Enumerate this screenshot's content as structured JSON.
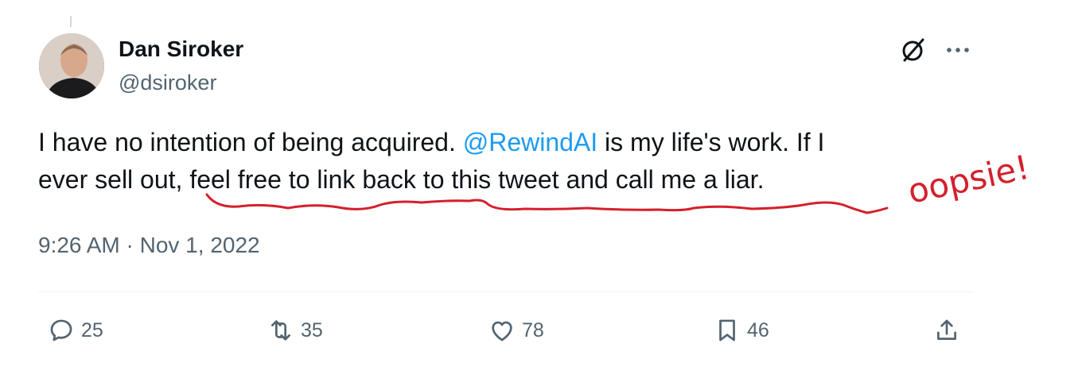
{
  "author": {
    "display_name": "Dan Siroker",
    "handle": "@dsiroker"
  },
  "tweet": {
    "line1_prefix": "I have no intention of being acquired. ",
    "mention": "@RewindAI",
    "line1_suffix": " is my life's work. If I",
    "line2": "ever sell out, feel free to link back to this tweet and call me a liar.",
    "timestamp": "9:26 AM · Nov 1, 2022"
  },
  "annotation": {
    "handwritten_text": "oopsie!",
    "color": "#d4202c"
  },
  "actions": {
    "replies": "25",
    "reposts": "35",
    "likes": "78",
    "bookmarks": "46"
  },
  "icons": [
    "grok-icon",
    "more-icon",
    "reply-icon",
    "repost-icon",
    "like-icon",
    "bookmark-icon",
    "share-icon"
  ],
  "colors": {
    "text": "#0f1419",
    "secondary": "#536471",
    "link": "#1d9bf0"
  }
}
